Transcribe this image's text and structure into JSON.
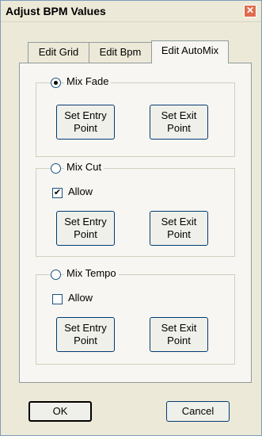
{
  "window": {
    "title": "Adjust BPM Values",
    "close_symbol": "✕"
  },
  "tabs": [
    {
      "label": "Edit Grid",
      "active": false
    },
    {
      "label": "Edit Bpm",
      "active": false
    },
    {
      "label": "Edit AutoMix",
      "active": true
    }
  ],
  "groups": {
    "mix_fade": {
      "label": "Mix Fade",
      "selected": true,
      "entry_button": "Set Entry\nPoint",
      "exit_button": "Set Exit\nPoint"
    },
    "mix_cut": {
      "label": "Mix Cut",
      "selected": false,
      "allow_label": "Allow",
      "allow_checked": true,
      "check_mark": "✔",
      "entry_button": "Set Entry\nPoint",
      "exit_button": "Set Exit\nPoint"
    },
    "mix_tempo": {
      "label": "Mix Tempo",
      "selected": false,
      "allow_label": "Allow",
      "allow_checked": false,
      "entry_button": "Set Entry\nPoint",
      "exit_button": "Set Exit\nPoint"
    }
  },
  "footer": {
    "ok_label": "OK",
    "cancel_label": "Cancel"
  }
}
